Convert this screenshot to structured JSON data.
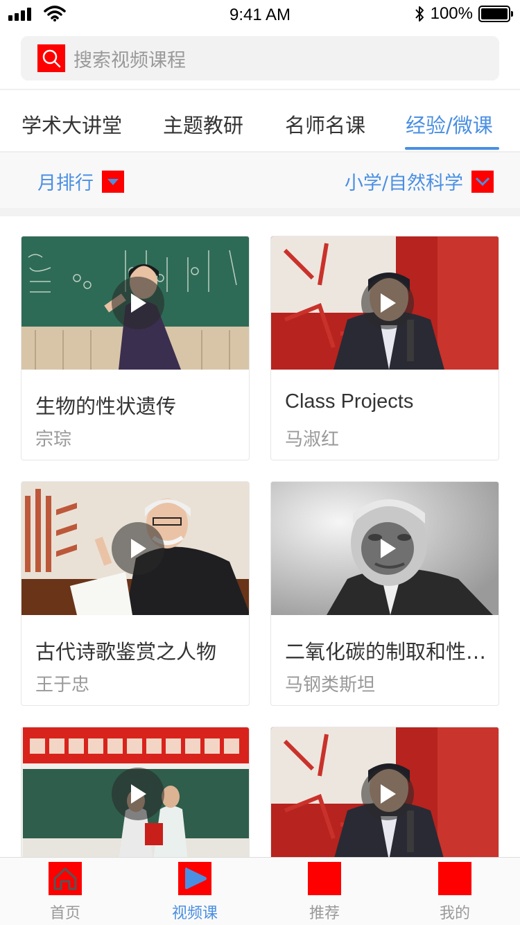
{
  "status_bar": {
    "time": "9:41 AM",
    "battery": "100%"
  },
  "search": {
    "placeholder": "搜索视频课程"
  },
  "tabs": [
    {
      "label": "学术大讲堂",
      "active": false
    },
    {
      "label": "主题教研",
      "active": false
    },
    {
      "label": "名师名课",
      "active": false
    },
    {
      "label": "经验/微课",
      "active": true
    }
  ],
  "filters": {
    "left": "月排行",
    "right": "小学/自然科学"
  },
  "videos": [
    {
      "title": "生物的性状遗传",
      "author": "宗琮"
    },
    {
      "title": "Class Projects",
      "author": "马淑红"
    },
    {
      "title": "古代诗歌鉴赏之人物",
      "author": "王于忠"
    },
    {
      "title": "二氧化碳的制取和性…",
      "author": "马钢类斯坦"
    },
    {
      "title": "",
      "author": ""
    },
    {
      "title": "",
      "author": ""
    }
  ],
  "bottom_nav": [
    {
      "label": "首页",
      "icon": "home-icon",
      "active": false
    },
    {
      "label": "视频课",
      "icon": "play-icon",
      "active": true
    },
    {
      "label": "推荐",
      "icon": "recommend-icon",
      "active": false
    },
    {
      "label": "我的",
      "icon": "profile-icon",
      "active": false
    }
  ],
  "colors": {
    "accent": "#4a8fe2",
    "icon_placeholder": "#ff0000"
  }
}
